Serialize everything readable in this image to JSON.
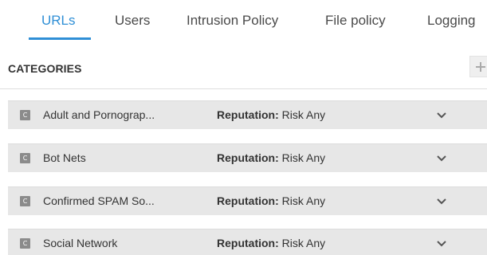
{
  "tabs": [
    {
      "label": "URLs",
      "active": true
    },
    {
      "label": "Users",
      "active": false
    },
    {
      "label": "Intrusion Policy",
      "active": false
    },
    {
      "label": "File policy",
      "active": false
    },
    {
      "label": "Logging",
      "active": false
    }
  ],
  "section": {
    "title": "CATEGORIES",
    "add_icon": "plus-icon"
  },
  "rows": [
    {
      "badge": "C",
      "name": "Adult and Pornograp...",
      "reputation_label": "Reputation:",
      "reputation_value": " Risk Any"
    },
    {
      "badge": "C",
      "name": "Bot Nets",
      "reputation_label": "Reputation:",
      "reputation_value": " Risk Any"
    },
    {
      "badge": "C",
      "name": "Confirmed SPAM So...",
      "reputation_label": "Reputation:",
      "reputation_value": " Risk Any"
    },
    {
      "badge": "C",
      "name": "Social Network",
      "reputation_label": "Reputation:",
      "reputation_value": " Risk Any"
    }
  ],
  "colors": {
    "accent": "#2f8fd6",
    "row_background": "#e7e7e7",
    "badge": "#8b8b8b"
  }
}
